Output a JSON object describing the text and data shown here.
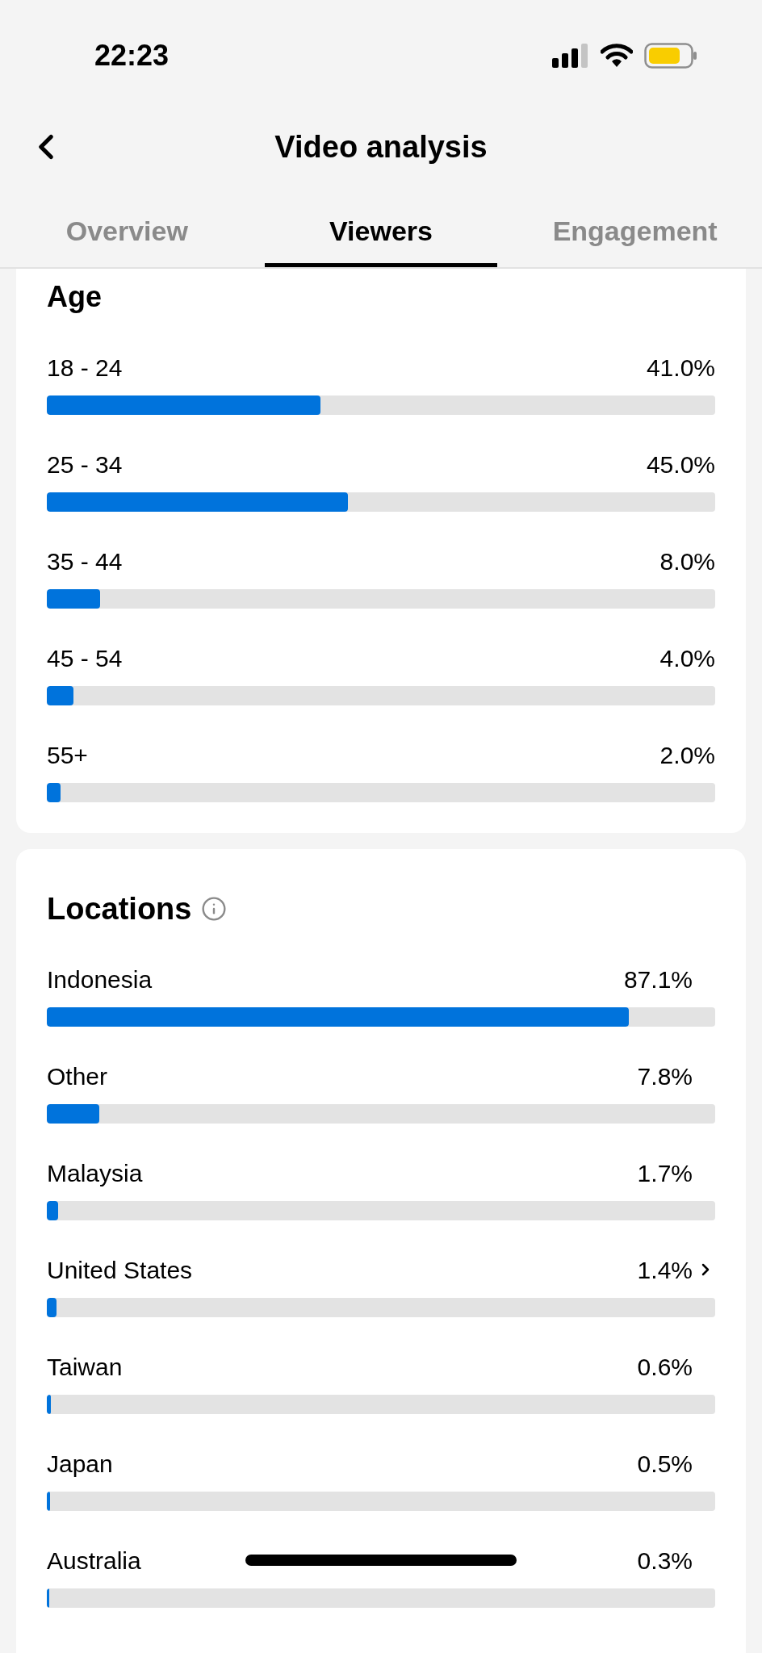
{
  "status_bar": {
    "time": "22:23"
  },
  "header": {
    "title": "Video analysis"
  },
  "tabs": [
    {
      "label": "Overview",
      "selected": false
    },
    {
      "label": "Viewers",
      "selected": true
    },
    {
      "label": "Engagement",
      "selected": false
    }
  ],
  "age": {
    "title": "Age",
    "rows": [
      {
        "label": "18 - 24",
        "reading": "41.0%",
        "level": 0.41
      },
      {
        "label": "25 - 34",
        "reading": "45.0%",
        "level": 0.45
      },
      {
        "label": "35 - 44",
        "reading": "8.0%",
        "level": 0.08
      },
      {
        "label": "45 - 54",
        "reading": "4.0%",
        "level": 0.04
      },
      {
        "label": "55+",
        "reading": "2.0%",
        "level": 0.02
      }
    ]
  },
  "locations": {
    "title": "Locations",
    "rows": [
      {
        "label": "Indonesia",
        "reading": "87.1%",
        "level": 0.871,
        "chevron": false
      },
      {
        "label": "Other",
        "reading": "7.8%",
        "level": 0.078,
        "chevron": false
      },
      {
        "label": "Malaysia",
        "reading": "1.7%",
        "level": 0.017,
        "chevron": false
      },
      {
        "label": "United States",
        "reading": "1.4%",
        "level": 0.014,
        "chevron": true
      },
      {
        "label": "Taiwan",
        "reading": "0.6%",
        "level": 0.006,
        "chevron": false
      },
      {
        "label": "Japan",
        "reading": "0.5%",
        "level": 0.005,
        "chevron": false
      },
      {
        "label": "Australia",
        "reading": "0.3%",
        "level": 0.003,
        "chevron": false
      }
    ]
  }
}
